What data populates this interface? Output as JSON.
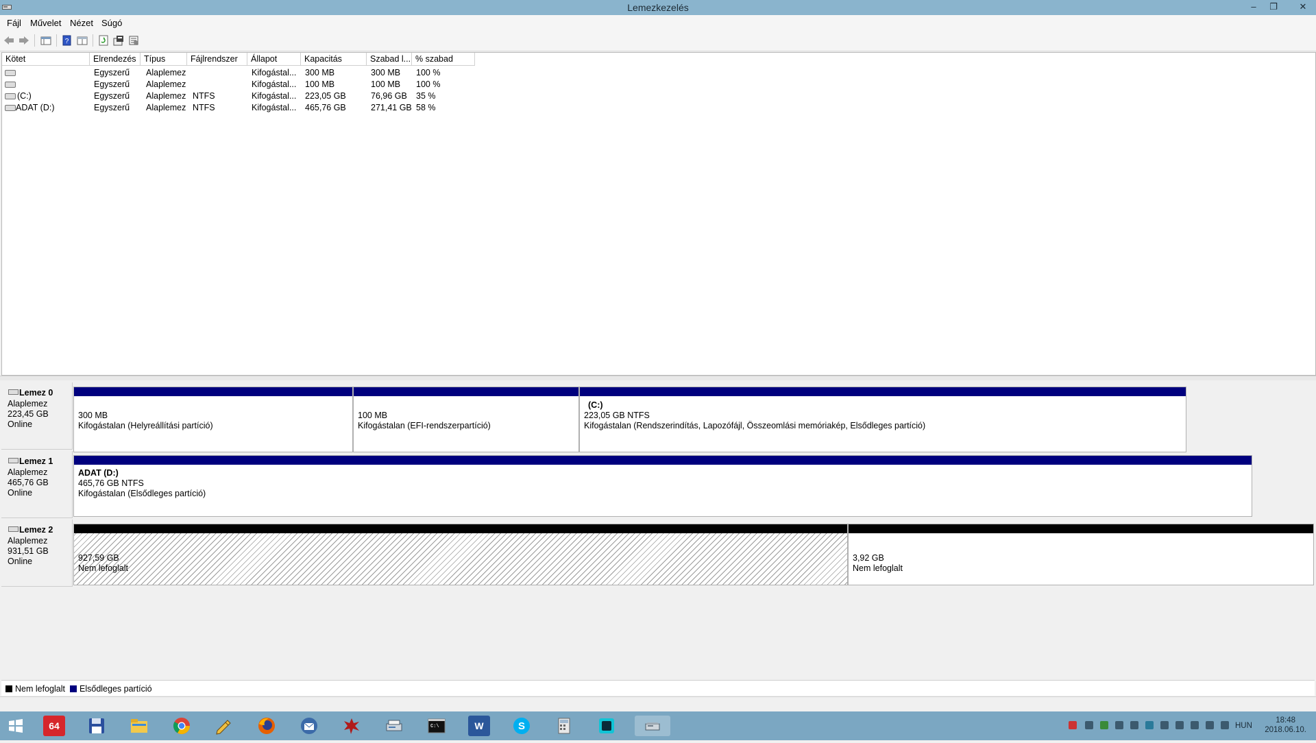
{
  "window": {
    "title": "Lemezkezelés"
  },
  "menu": [
    "Fájl",
    "Művelet",
    "Nézet",
    "Súgó"
  ],
  "columns": [
    "Kötet",
    "Elrendezés",
    "Típus",
    "Fájlrendszer",
    "Állapot",
    "Kapacitás",
    "Szabad l...",
    "% szabad"
  ],
  "volumes": [
    [
      "",
      "Egyszerű",
      "Alaplemez",
      "",
      "Kifogástal...",
      "300 MB",
      "300 MB",
      "100 %"
    ],
    [
      "",
      "Egyszerű",
      "Alaplemez",
      "",
      "Kifogástal...",
      "100 MB",
      "100 MB",
      "100 %"
    ],
    [
      "(C:)",
      "Egyszerű",
      "Alaplemez",
      "NTFS",
      "Kifogástal...",
      "223,05 GB",
      "76,96 GB",
      "35 %"
    ],
    [
      "ADAT (D:)",
      "Egyszerű",
      "Alaplemez",
      "NTFS",
      "Kifogástal...",
      "465,76 GB",
      "271,41 GB",
      "58 %"
    ]
  ],
  "disks": [
    {
      "name": "Lemez 0",
      "type": "Alaplemez",
      "size": "223,45 GB",
      "status": "Online",
      "partitions": [
        {
          "label": "",
          "size": "300 MB",
          "status": "Kifogástalan (Helyreállítási partíció)"
        },
        {
          "label": "",
          "size": "100 MB",
          "status": "Kifogástalan (EFI-rendszerpartíció)"
        },
        {
          "label": "(C:)",
          "size": "223,05 GB NTFS",
          "status": "Kifogástalan (Rendszerindítás, Lapozófájl, Összeomlási memóriakép, Elsődleges partíció)"
        }
      ]
    },
    {
      "name": "Lemez 1",
      "type": "Alaplemez",
      "size": "465,76 GB",
      "status": "Online",
      "partitions": [
        {
          "label": "ADAT  (D:)",
          "size": "465,76 GB NTFS",
          "status": "Kifogástalan (Elsődleges partíció)"
        }
      ]
    },
    {
      "name": "Lemez 2",
      "type": "Alaplemez",
      "size": "931,51 GB",
      "status": "Online",
      "partitions": [
        {
          "label": "",
          "size": "927,59 GB",
          "status": "Nem lefoglalt"
        },
        {
          "label": "",
          "size": "3,92 GB",
          "status": "Nem lefoglalt"
        }
      ]
    }
  ],
  "legend": {
    "unallocated": "Nem lefoglalt",
    "primary": "Elsődleges partíció"
  },
  "colors": {
    "primary": "#00007e",
    "unallocated": "#000000",
    "titlebar": "#8ab4cd",
    "taskbar": "#7ba7c2"
  },
  "taskbar": {
    "apps": [
      "start-icon",
      "aida64-icon",
      "save-disk-icon",
      "file-explorer-icon",
      "chrome-icon",
      "pen-tool-icon",
      "firefox-icon",
      "thunderbird-icon",
      "splatter-app-icon",
      "scanner-icon",
      "command-prompt-icon",
      "word-icon",
      "skype-icon",
      "calculator-icon",
      "square-app-icon",
      "disk-management-icon"
    ],
    "badge_64": "64",
    "word_letter": "W",
    "language": "HUN",
    "time": "18:48",
    "date": "2018.06.10."
  }
}
